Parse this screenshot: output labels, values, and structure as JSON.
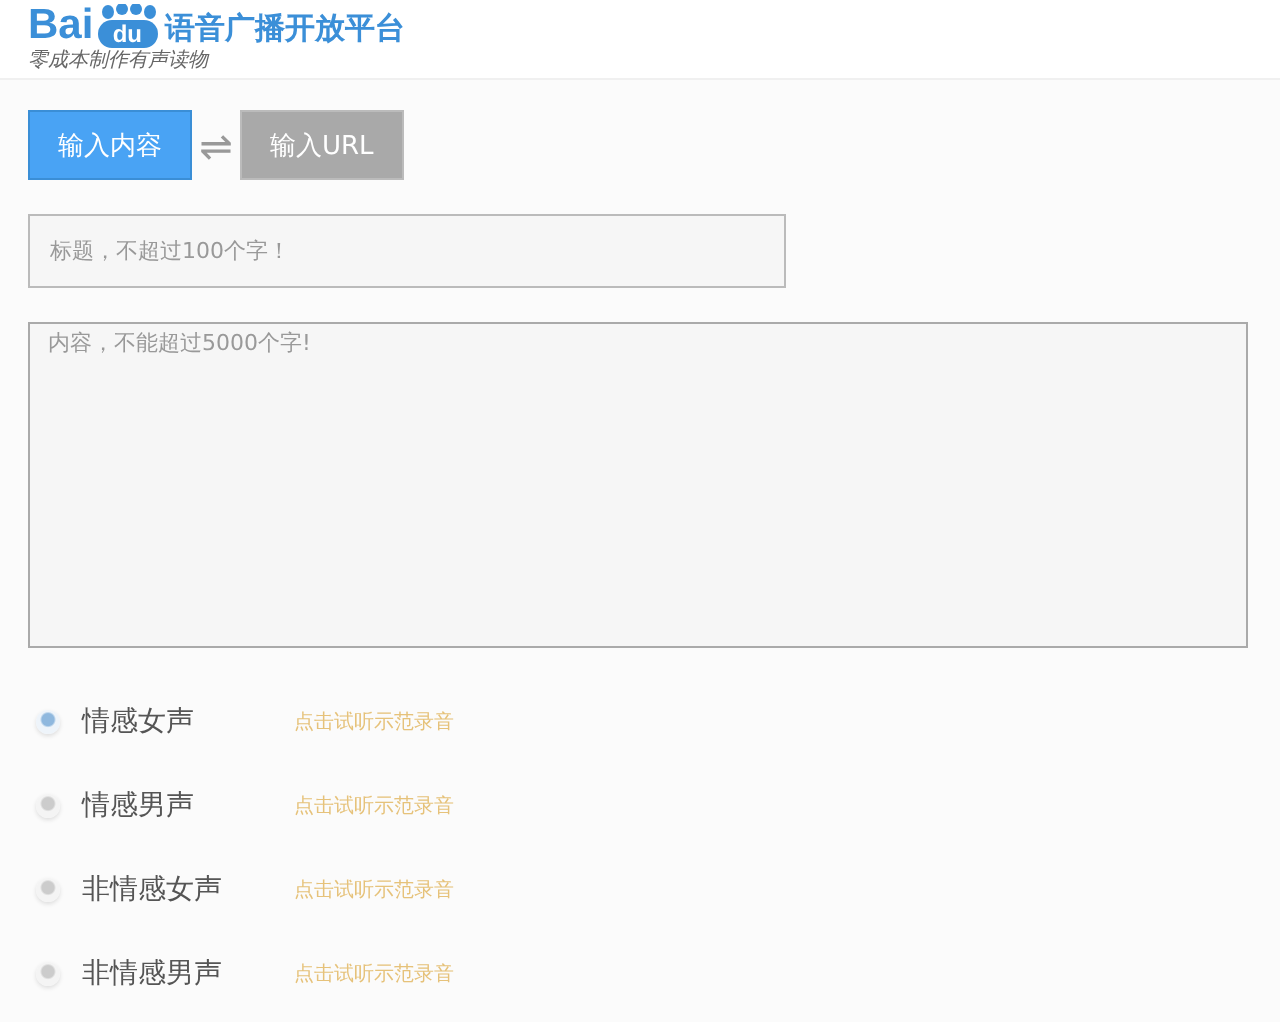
{
  "header": {
    "logo_text": "Bai",
    "logo_paw_text": "du",
    "title": "语音广播开放平台",
    "tagline": "零成本制作有声读物"
  },
  "tabs": [
    {
      "label": "输入内容",
      "selected": true
    },
    {
      "label": "输入URL",
      "selected": false
    }
  ],
  "swap_symbol": "⇌",
  "title_field": {
    "placeholder": "标题，不超过100个字！"
  },
  "content_field": {
    "placeholder": "内容，不能超过5000个字!"
  },
  "voices": [
    {
      "label": "情感女声",
      "selected": true,
      "sample_link": "点击试听示范录音"
    },
    {
      "label": "情感男声",
      "selected": false,
      "sample_link": "点击试听示范录音"
    },
    {
      "label": "非情感女声",
      "selected": false,
      "sample_link": "点击试听示范录音"
    },
    {
      "label": "非情感男声",
      "selected": false,
      "sample_link": "点击试听示范录音"
    }
  ]
}
